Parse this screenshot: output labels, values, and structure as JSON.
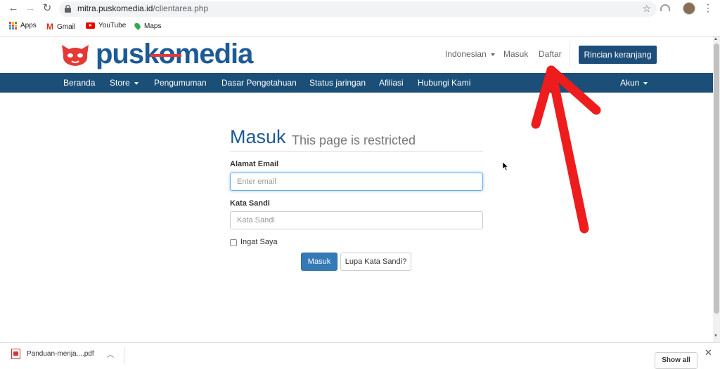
{
  "browser": {
    "url_host": "mitra.puskomedia.id",
    "url_path": "/clientarea.php",
    "bookmarks": [
      "Apps",
      "Gmail",
      "YouTube",
      "Maps"
    ]
  },
  "site": {
    "logo_text": "puskomedia",
    "top_links": {
      "language": "Indonesian",
      "login": "Masuk",
      "register": "Daftar"
    },
    "cart_button": "Rincian keranjang",
    "nav": [
      "Beranda",
      "Store",
      "Pengumuman",
      "Dasar Pengetahuan",
      "Status jaringan",
      "Afiliasi",
      "Hubungi Kami"
    ],
    "account": "Akun",
    "colors": {
      "brand_blue": "#1d5a96",
      "nav_bg": "#1b4f78",
      "primary_btn": "#337ab7",
      "logo_red": "#e53935"
    }
  },
  "login": {
    "title": "Masuk",
    "subtitle": "This page is restricted",
    "email_label": "Alamat Email",
    "email_placeholder": "Enter email",
    "password_label": "Kata Sandi",
    "password_placeholder": "Kata Sandi",
    "remember_label": "Ingat Saya",
    "submit": "Masuk",
    "forgot": "Lupa Kata Sandi?"
  },
  "downloads": {
    "file": "Panduan-menja....pdf",
    "show_all": "Show all"
  }
}
